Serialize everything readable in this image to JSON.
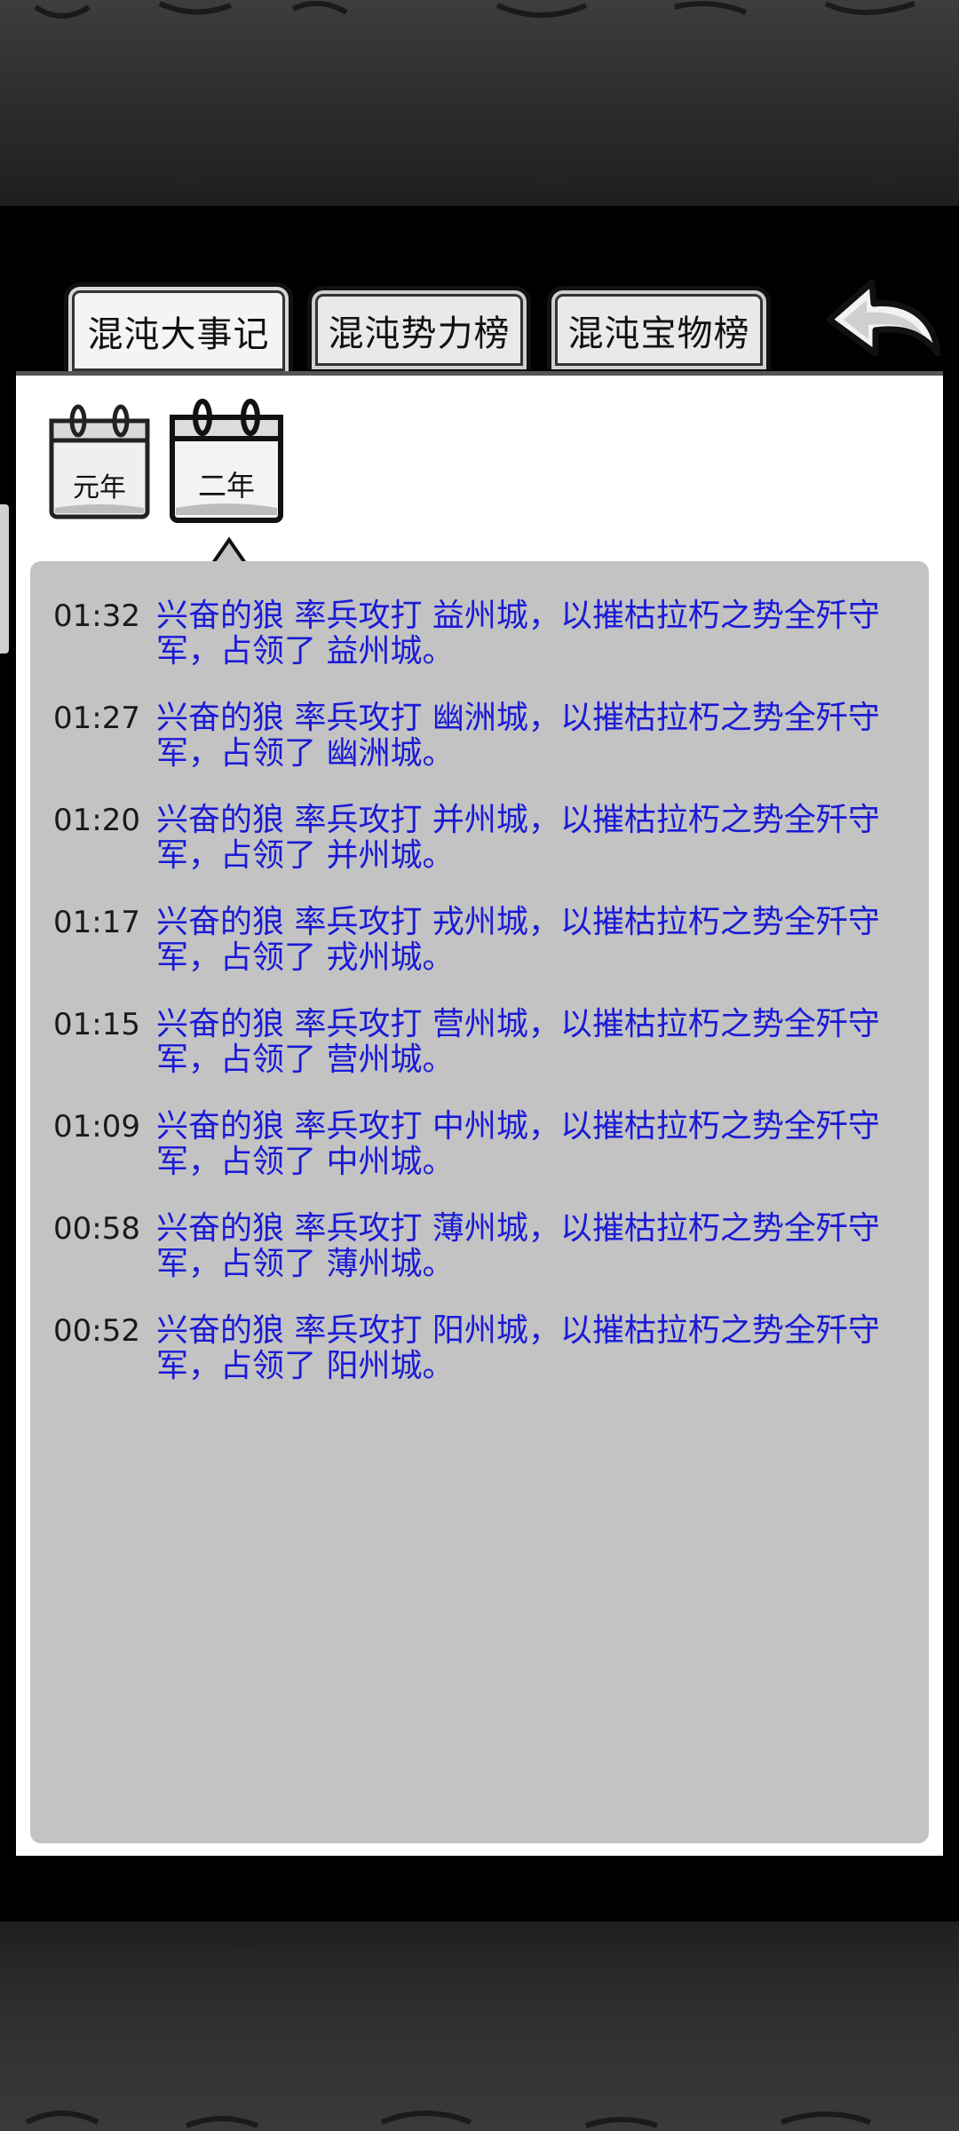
{
  "tabs": [
    {
      "label": "混沌大事记",
      "active": true
    },
    {
      "label": "混沌势力榜",
      "active": false
    },
    {
      "label": "混沌宝物榜",
      "active": false
    }
  ],
  "back_icon": "back-arrow-icon",
  "calendars": [
    {
      "label": "元年",
      "selected": false
    },
    {
      "label": "二年",
      "selected": true
    }
  ],
  "events": [
    {
      "time": "01:32",
      "text": "兴奋的狼 率兵攻打 益州城，以摧枯拉朽之势全歼守军，占领了 益州城。"
    },
    {
      "time": "01:27",
      "text": "兴奋的狼 率兵攻打 幽洲城，以摧枯拉朽之势全歼守军，占领了 幽洲城。"
    },
    {
      "time": "01:20",
      "text": "兴奋的狼 率兵攻打 并州城，以摧枯拉朽之势全歼守军，占领了 并州城。"
    },
    {
      "time": "01:17",
      "text": "兴奋的狼 率兵攻打 戎州城，以摧枯拉朽之势全歼守军，占领了 戎州城。"
    },
    {
      "time": "01:15",
      "text": "兴奋的狼 率兵攻打 营州城，以摧枯拉朽之势全歼守军，占领了 营州城。"
    },
    {
      "time": "01:09",
      "text": "兴奋的狼 率兵攻打 中州城，以摧枯拉朽之势全歼守军，占领了 中州城。"
    },
    {
      "time": "00:58",
      "text": "兴奋的狼 率兵攻打 薄州城，以摧枯拉朽之势全歼守军，占领了 薄州城。"
    },
    {
      "time": "00:52",
      "text": "兴奋的狼 率兵攻打 阳州城，以摧枯拉朽之势全歼守军，占领了 阳州城。"
    }
  ],
  "colors": {
    "event_text": "#1a1ad6",
    "event_time": "#1a1a1a",
    "list_background": "#c3c3c3",
    "panel_background": "#ffffff",
    "page_background": "#000000"
  }
}
